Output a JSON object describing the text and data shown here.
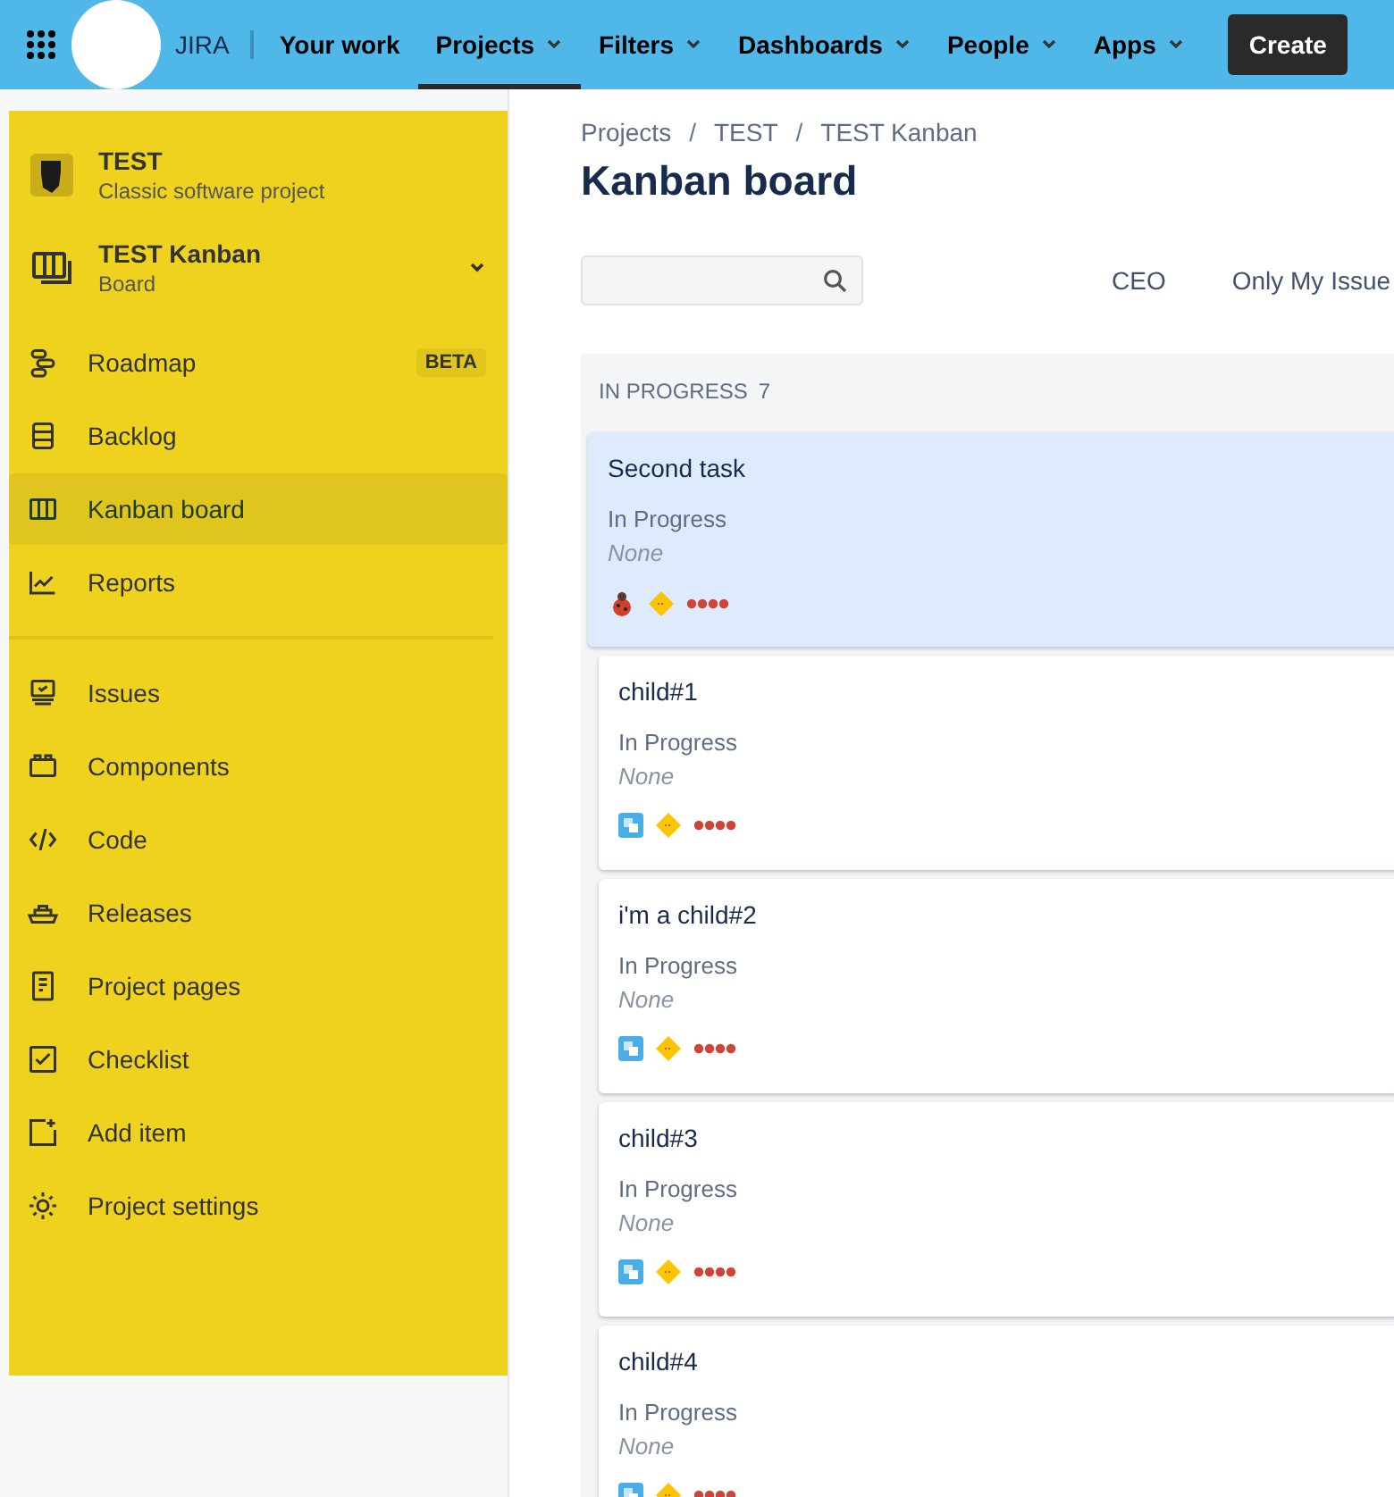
{
  "topnav": {
    "product": "JIRA",
    "items": [
      {
        "label": "Your work",
        "dropdown": false,
        "selected": false
      },
      {
        "label": "Projects",
        "dropdown": true,
        "selected": true
      },
      {
        "label": "Filters",
        "dropdown": true,
        "selected": false
      },
      {
        "label": "Dashboards",
        "dropdown": true,
        "selected": false
      },
      {
        "label": "People",
        "dropdown": true,
        "selected": false
      },
      {
        "label": "Apps",
        "dropdown": true,
        "selected": false
      }
    ],
    "create_button": "Create"
  },
  "sidebar": {
    "project": {
      "name": "TEST",
      "type": "Classic software project"
    },
    "board": {
      "name": "TEST Kanban",
      "type": "Board",
      "expanded": true
    },
    "groups": [
      [
        {
          "label": "Roadmap",
          "kind": "roadmap",
          "badge": "BETA",
          "selected": false
        },
        {
          "label": "Backlog",
          "kind": "backlog",
          "selected": false
        },
        {
          "label": "Kanban board",
          "kind": "board",
          "selected": true
        },
        {
          "label": "Reports",
          "kind": "reports",
          "selected": false
        }
      ],
      [
        {
          "label": "Issues",
          "kind": "issues",
          "selected": false
        },
        {
          "label": "Components",
          "kind": "components",
          "selected": false
        },
        {
          "label": "Code",
          "kind": "code",
          "selected": false
        },
        {
          "label": "Releases",
          "kind": "releases",
          "selected": false
        },
        {
          "label": "Project pages",
          "kind": "pages",
          "selected": false
        },
        {
          "label": "Checklist",
          "kind": "checklist",
          "selected": false
        },
        {
          "label": "Add item",
          "kind": "add",
          "selected": false
        },
        {
          "label": "Project settings",
          "kind": "settings",
          "selected": false
        }
      ]
    ]
  },
  "breadcrumbs": [
    {
      "kind": "link",
      "text": "Projects"
    },
    {
      "kind": "separator",
      "text": "/"
    },
    {
      "kind": "link",
      "text": "TEST"
    },
    {
      "kind": "separator",
      "text": "/"
    },
    {
      "kind": "link",
      "text": "TEST Kanban"
    }
  ],
  "title": "Kanban board",
  "quick_filters": [
    "CEO",
    "Only My Issue"
  ],
  "column": {
    "title": "IN PROGRESS",
    "count": "7",
    "cards": [
      {
        "summary": "Second task",
        "status": "In Progress",
        "field": "None",
        "kind": "bug",
        "selected": true
      },
      {
        "summary": "child#1",
        "status": "In Progress",
        "field": "None",
        "kind": "subtask",
        "selected": false
      },
      {
        "summary": "i'm a child#2",
        "status": "In Progress",
        "field": "None",
        "kind": "subtask",
        "selected": false
      },
      {
        "summary": "child#3",
        "status": "In Progress",
        "field": "None",
        "kind": "subtask",
        "selected": false
      },
      {
        "summary": "child#4",
        "status": "In Progress",
        "field": "None",
        "kind": "subtask",
        "selected": false
      }
    ]
  }
}
